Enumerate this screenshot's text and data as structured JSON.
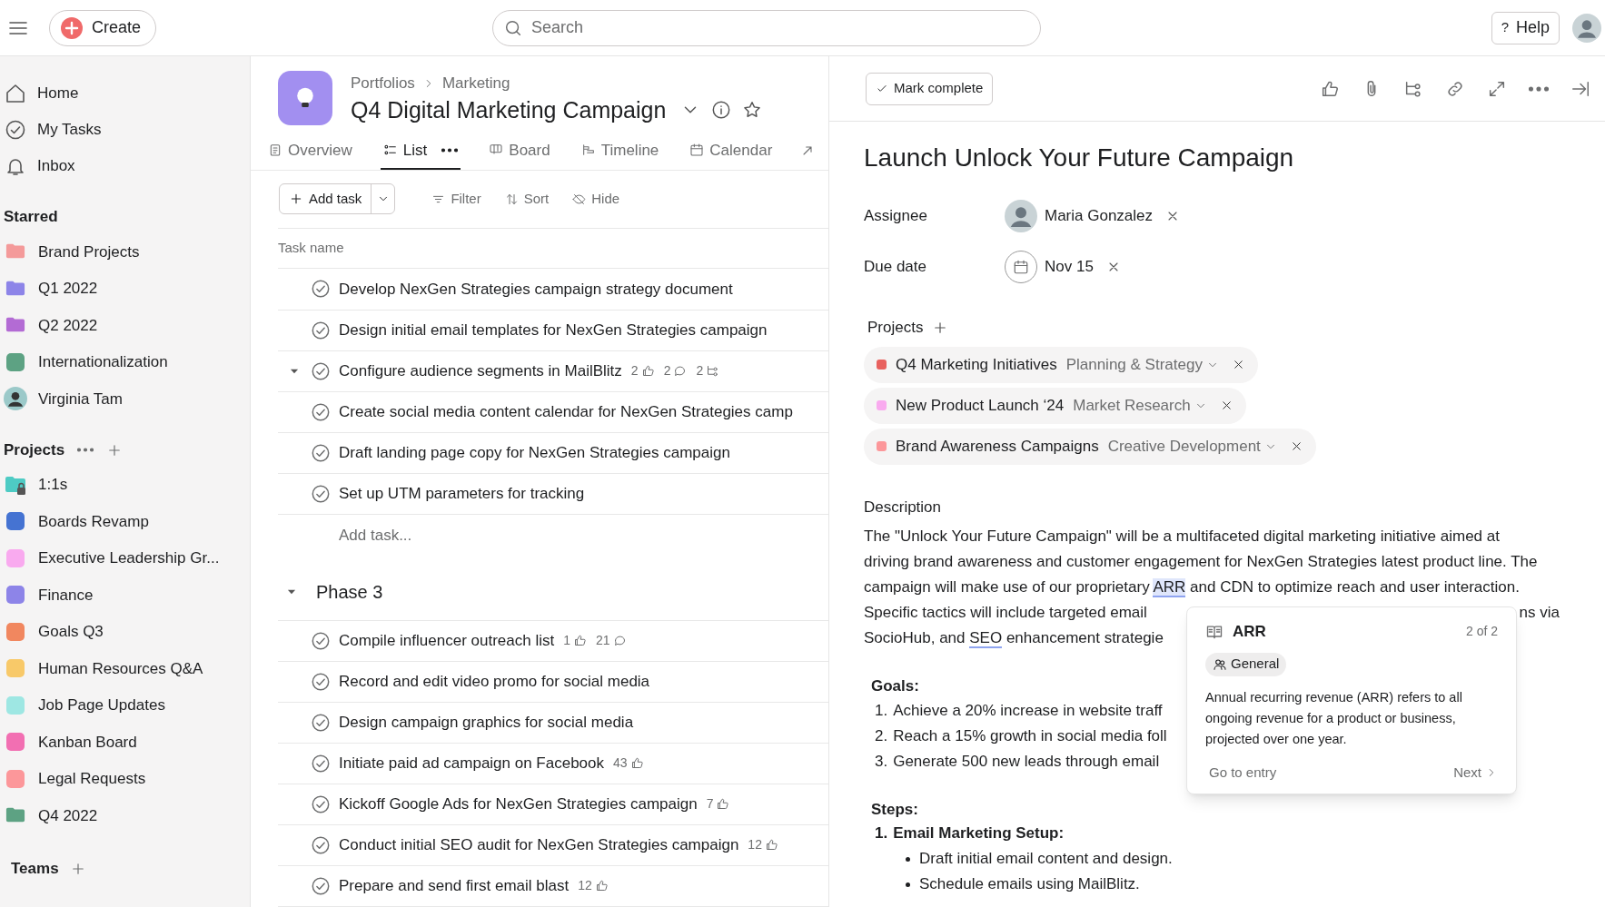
{
  "topbar": {
    "create_label": "Create",
    "search_placeholder": "Search",
    "help_label": "Help",
    "help_icon": "?"
  },
  "sidebar": {
    "nav": [
      {
        "label": "Home",
        "kind": "home"
      },
      {
        "label": "My Tasks",
        "kind": "tasks"
      },
      {
        "label": "Inbox",
        "kind": "inbox"
      }
    ],
    "starred_heading": "Starred",
    "starred": [
      {
        "label": "Brand Projects",
        "kind": "folder",
        "color": "#f49a9a"
      },
      {
        "label": "Q1 2022",
        "kind": "folder",
        "color": "#8d84e8"
      },
      {
        "label": "Q2 2022",
        "kind": "folder",
        "color": "#b36bd4"
      },
      {
        "label": "Internationalization",
        "kind": "square",
        "color": "#5da283"
      },
      {
        "label": "Virginia Tam",
        "kind": "avatar",
        "color": "#9bc9c9"
      }
    ],
    "projects_heading": "Projects",
    "projects": [
      {
        "label": "1:1s",
        "kind": "locked-folder",
        "color": "#4ecbc4"
      },
      {
        "label": "Boards Revamp",
        "kind": "square",
        "color": "#4573d2"
      },
      {
        "label": "Executive Leadership Gr...",
        "kind": "square",
        "color": "#f9aaef"
      },
      {
        "label": "Finance",
        "kind": "square",
        "color": "#8d84e8"
      },
      {
        "label": "Goals Q3",
        "kind": "square",
        "color": "#f1875f"
      },
      {
        "label": "Human Resources Q&A",
        "kind": "square",
        "color": "#f8c969"
      },
      {
        "label": "Job Page Updates",
        "kind": "square",
        "color": "#9ee7e3"
      },
      {
        "label": "Kanban Board",
        "kind": "square",
        "color": "#f26fb2"
      },
      {
        "label": "Legal Requests",
        "kind": "square",
        "color": "#fc979a"
      },
      {
        "label": "Q4 2022",
        "kind": "folder",
        "color": "#5da283"
      }
    ],
    "teams_heading": "Teams"
  },
  "project": {
    "breadcrumb": [
      "Portfolios",
      "Marketing"
    ],
    "title": "Q4 Digital Marketing Campaign",
    "tabs": [
      {
        "label": "Overview",
        "kind": "overview",
        "selected": false
      },
      {
        "label": "List",
        "kind": "list",
        "selected": true
      },
      {
        "label": "Board",
        "kind": "board",
        "selected": false
      },
      {
        "label": "Timeline",
        "kind": "timeline",
        "selected": false
      },
      {
        "label": "Calendar",
        "kind": "calendar",
        "selected": false
      }
    ],
    "toolbar": {
      "add_task": "Add task",
      "filter": "Filter",
      "sort": "Sort",
      "hide": "Hide"
    },
    "column": "Task name",
    "groups": [
      {
        "tasks": [
          {
            "name": "Develop NexGen Strategies campaign strategy document",
            "kind": "task"
          },
          {
            "name": "Design initial email templates for NexGen Strategies campaign",
            "kind": "task"
          },
          {
            "name": "Configure audience segments in MailBlitz",
            "kind": "parent",
            "expanded": true,
            "likes": "2",
            "comments": "2",
            "subtasks": "2"
          },
          {
            "name": "Create social media content calendar for NexGen Strategies camp",
            "kind": "task"
          },
          {
            "name": "Draft landing page copy for NexGen Strategies campaign",
            "kind": "task"
          },
          {
            "name": "Set up UTM parameters for tracking",
            "kind": "task"
          }
        ],
        "add_task_placeholder": "Add task..."
      },
      {
        "heading": "Phase 3",
        "expanded": true,
        "tasks": [
          {
            "name": "Compile influencer outreach list",
            "kind": "task",
            "likes": "1",
            "comments": "21"
          },
          {
            "name": "Record and edit video promo for social media",
            "kind": "task"
          },
          {
            "name": "Design campaign graphics for social media",
            "kind": "task"
          },
          {
            "name": "Initiate paid ad campaign on Facebook",
            "kind": "task",
            "likes": "43"
          },
          {
            "name": "Kickoff Google Ads for NexGen Strategies campaign",
            "kind": "task",
            "likes": "7"
          },
          {
            "name": "Conduct initial SEO audit for NexGen Strategies campaign",
            "kind": "task",
            "likes": "12"
          },
          {
            "name": "Prepare and send first email blast",
            "kind": "task",
            "likes": "12"
          }
        ]
      }
    ]
  },
  "task": {
    "mark_complete": "Mark complete",
    "title": "Launch Unlock Your Future Campaign",
    "fields": [
      {
        "label": "Assignee",
        "kind": "person",
        "value": "Maria Gonzalez"
      },
      {
        "label": "Due date",
        "kind": "date",
        "value": "Nov 15"
      }
    ],
    "projects_heading": "Projects",
    "projects": [
      {
        "name": "Q4 Marketing Initiatives",
        "section": "Planning & Strategy",
        "color": "#e8615e"
      },
      {
        "name": "New Product Launch ‘24",
        "section": "Market Research",
        "color": "#f9aaef"
      },
      {
        "name": "Brand Awareness Campaigns",
        "section": "Creative Development",
        "color": "#fc979a"
      }
    ],
    "description_heading": "Description",
    "description_lines": [
      {
        "segments": [
          {
            "kind": "text",
            "text": "The \"Unlock Your Future Campaign\" will be a multifaceted digital marketing initiative aimed at"
          }
        ]
      },
      {
        "segments": [
          {
            "kind": "text",
            "text": "driving brand awareness and customer engagement for NexGen Strategies latest product line. The"
          }
        ]
      },
      {
        "segments": [
          {
            "kind": "text",
            "text": "campaign will make use of our proprietary"
          },
          {
            "kind": "term",
            "text": "ARR",
            "active": true
          },
          {
            "kind": "text",
            "text": "and CDN to optimize reach and user interaction."
          }
        ]
      },
      {
        "segments": [
          {
            "kind": "text",
            "text": "Specific tactics will include targeted email"
          }
        ],
        "trailing": "ns via"
      },
      {
        "segments": [
          {
            "kind": "text",
            "text": "SocioHub, and"
          },
          {
            "kind": "term",
            "text": "SEO",
            "active": false
          },
          {
            "kind": "text",
            "text": "enhancement strategie"
          }
        ]
      }
    ],
    "goals_heading": "Goals:",
    "goals": [
      {
        "number": "1.",
        "text": "Achieve a 20% increase in website traff"
      },
      {
        "number": "2.",
        "text": "Reach a 15% growth in social media foll"
      },
      {
        "number": "3.",
        "text": "Generate 500 new leads through email"
      }
    ],
    "steps_heading": "Steps:",
    "steps": [
      {
        "number": "1.",
        "title": "Email Marketing Setup:",
        "bullets": [
          "Draft initial email content and design.",
          "Schedule emails using MailBlitz."
        ]
      }
    ]
  },
  "popup": {
    "title": "ARR",
    "counter": "2 of 2",
    "tag": "General",
    "body": "Annual recurring revenue (ARR) refers to all ongoing revenue for a product or business, projected over one year.",
    "go_to": "Go to entry",
    "next": "Next"
  }
}
